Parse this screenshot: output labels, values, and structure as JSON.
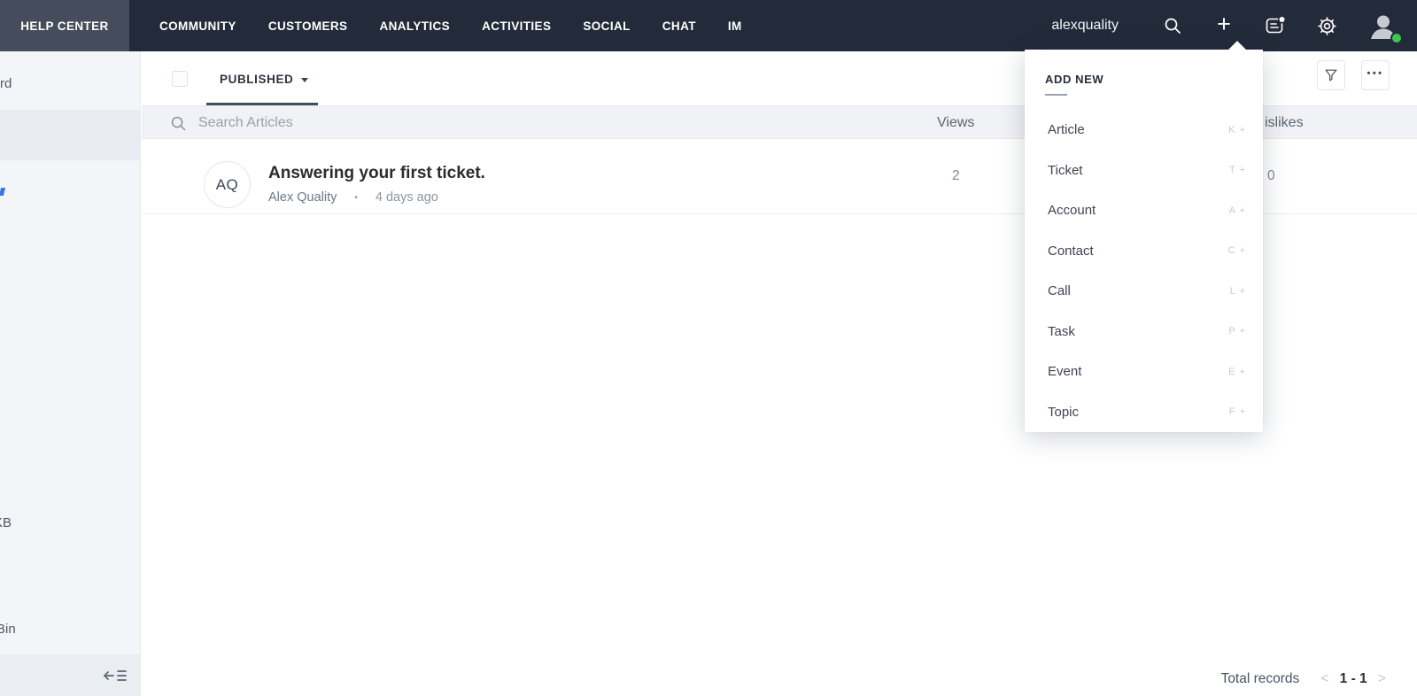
{
  "colors": {
    "topbar_bg": "#232b3a",
    "active_tab_bg": "#454d5c",
    "presence_green": "#3ec651",
    "sidebar_bg": "#f4f5f8",
    "sidebar_selected": "#e9ecf3",
    "header_row_bg": "#f0f2f6",
    "accent_blue": "#2f7ce8"
  },
  "topnav": {
    "items": [
      {
        "label": "HELP CENTER"
      },
      {
        "label": "COMMUNITY"
      },
      {
        "label": "CUSTOMERS"
      },
      {
        "label": "ANALYTICS"
      },
      {
        "label": "ACTIVITIES"
      },
      {
        "label": "SOCIAL"
      },
      {
        "label": "CHAT"
      },
      {
        "label": "IM"
      }
    ],
    "username": "alexquality"
  },
  "add_new_menu": {
    "title": "ADD NEW",
    "items": [
      {
        "label": "Article",
        "shortcut": "K +"
      },
      {
        "label": "Ticket",
        "shortcut": "T +"
      },
      {
        "label": "Account",
        "shortcut": "A +"
      },
      {
        "label": "Contact",
        "shortcut": "C +"
      },
      {
        "label": "Call",
        "shortcut": "L +"
      },
      {
        "label": "Task",
        "shortcut": "P +"
      },
      {
        "label": "Event",
        "shortcut": "E +"
      },
      {
        "label": "Topic",
        "shortcut": "F +"
      }
    ]
  },
  "sidebar": {
    "fragment_top": "rd",
    "fragment_kb": "KB",
    "fragment_bin": "Bin"
  },
  "toolbar": {
    "view_filter": "PUBLISHED",
    "more_dots": "•••"
  },
  "articles": {
    "search_placeholder": "Search Articles",
    "views_header": "Views",
    "dislikes_header_fragment": "islikes",
    "rows": [
      {
        "initials": "AQ",
        "title": "Answering your first ticket.",
        "author": "Alex Quality",
        "separator": "•",
        "time": "4 days ago",
        "views": "2",
        "dislikes": "0"
      }
    ]
  },
  "pagination": {
    "label": "Total records",
    "range": "1 - 1",
    "prev": "<",
    "next": ">"
  }
}
